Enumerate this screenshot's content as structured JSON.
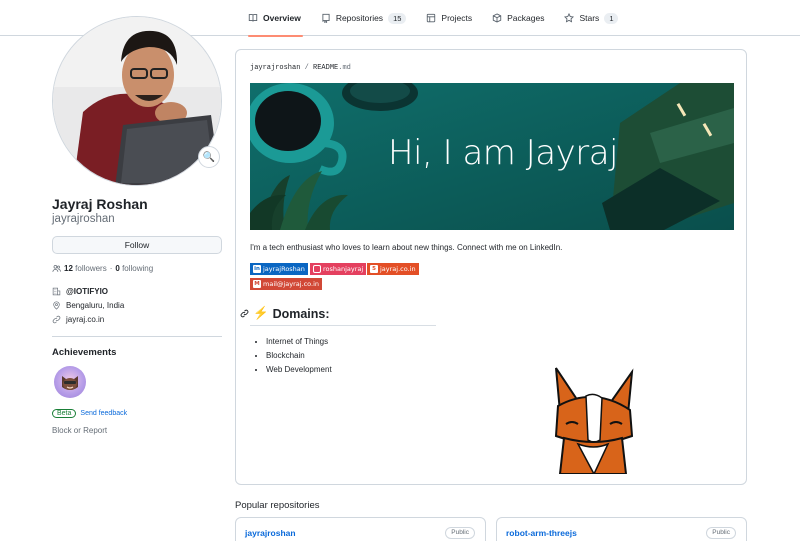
{
  "nav": {
    "tabs": [
      {
        "label": "Overview",
        "icon": "book-icon",
        "active": true
      },
      {
        "label": "Repositories",
        "icon": "repo-icon",
        "count": "15"
      },
      {
        "label": "Projects",
        "icon": "table-icon"
      },
      {
        "label": "Packages",
        "icon": "package-icon"
      },
      {
        "label": "Stars",
        "icon": "star-icon",
        "count": "1"
      }
    ]
  },
  "profile": {
    "status_emoji": "🔍",
    "full_name": "Jayraj Roshan",
    "username": "jayrajroshan",
    "follow_label": "Follow",
    "followers_count": "12",
    "followers_label": "followers",
    "separator": "·",
    "following_count": "0",
    "following_label": "following",
    "organization": "@IOTIFYIO",
    "location": "Bengaluru, India",
    "website": "jayraj.co.in",
    "achievements_title": "Achievements",
    "beta_label": "Beta",
    "feedback_label": "Send feedback",
    "block_label": "Block or Report"
  },
  "readme": {
    "owner": "jayrajroshan",
    "slash": "/",
    "file_name": "README",
    "file_ext": ".md",
    "banner_text": "Hi, I am Jayraj",
    "intro": "I'm a tech enthusiast who loves to learn about new things. Connect with me on LinkedIn.",
    "badges": [
      {
        "label": "jayrajRoshan",
        "icon": "linkedin-icon",
        "color": "#0a66c2"
      },
      {
        "label": "roshanjayraj",
        "icon": "instagram-icon",
        "color": "#e4405f"
      },
      {
        "label": "jayraj.co.in",
        "icon": "html5-icon",
        "color": "#e34f26"
      },
      {
        "label": "mail@jayraj.co.in",
        "icon": "gmail-icon",
        "color": "#d14836"
      }
    ],
    "domains_emoji": "⚡",
    "domains_title": "Domains:",
    "domains": [
      "Internet of Things",
      "Blockchain",
      "Web Development"
    ]
  },
  "popular": {
    "title": "Popular repositories",
    "repos": [
      {
        "name": "jayrajroshan",
        "visibility": "Public"
      },
      {
        "name": "robot-arm-threejs",
        "visibility": "Public"
      }
    ]
  }
}
